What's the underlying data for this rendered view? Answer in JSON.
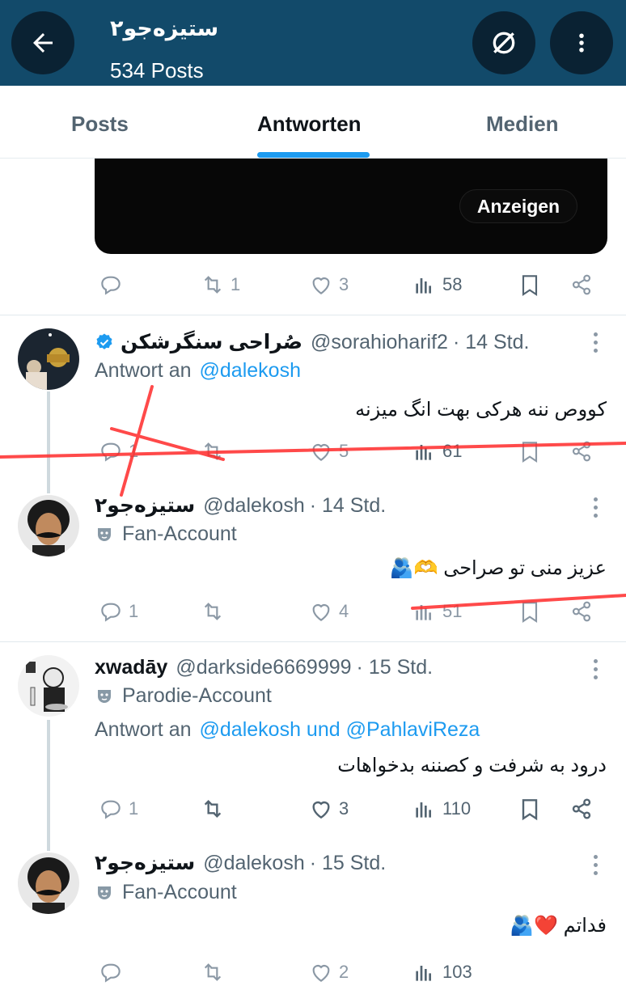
{
  "header": {
    "name": "ستیزه‌جو۲",
    "posts_count": "534 Posts"
  },
  "tabs": [
    {
      "label": "Posts",
      "active": false
    },
    {
      "label": "Antworten",
      "active": true
    },
    {
      "label": "Medien",
      "active": false
    }
  ],
  "media_card": {
    "show_label": "Anzeigen"
  },
  "first_actions": {
    "replies": "",
    "reposts": "1",
    "likes": "3",
    "views": "58"
  },
  "posts": [
    {
      "name": "صُراحی سنگرشکن",
      "verified": true,
      "handle": "@sorahioharif2",
      "time": "· 14 Std.",
      "reply_prefix": "Antwort an",
      "reply_to": "@dalekosh",
      "text": "کووص ننه هرکی بهت انگ میزنه",
      "replies": "1",
      "reposts": "",
      "likes": "5",
      "views": "61"
    },
    {
      "name": "ستیزه‌جو۲",
      "handle": "@dalekosh",
      "time": "· 14 Std.",
      "label": "Fan-Account",
      "text": "عزیز منی تو صراحی 🫶🫂",
      "replies": "1",
      "reposts": "",
      "likes": "4",
      "views": "51"
    },
    {
      "name": "xwadāy",
      "handle": "@darkside6669999",
      "time": "· 15 Std.",
      "label": "Parodie-Account",
      "reply_prefix": "Antwort an",
      "reply_to": "@dalekosh und @PahlaviReza",
      "text": "درود به شرفت و کصننه بدخواهات",
      "replies": "1",
      "reposts": "",
      "likes": "3",
      "views": "110"
    },
    {
      "name": "ستیزه‌جو۲",
      "handle": "@dalekosh",
      "time": "· 15 Std.",
      "label": "Fan-Account",
      "text": "فداتم ❤️🫂",
      "replies": "",
      "reposts": "",
      "likes": "2",
      "views": "103"
    }
  ],
  "colors": {
    "header_bg": "#124a6a",
    "accent": "#1d9bf0",
    "annotation_red": "#ff2a2a"
  }
}
